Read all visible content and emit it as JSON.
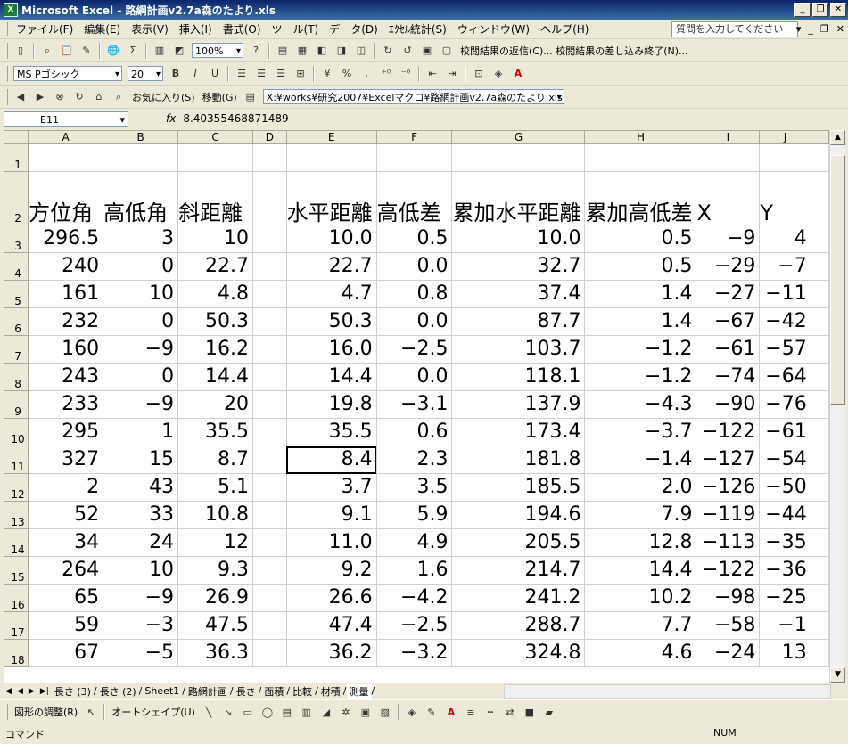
{
  "window": {
    "title": "Microsoft Excel - 路網計画v2.7a森のたより.xls"
  },
  "menu": [
    "ファイル(F)",
    "編集(E)",
    "表示(V)",
    "挿入(I)",
    "書式(O)",
    "ツール(T)",
    "データ(D)",
    "ｴｸｾﾙ統計(S)",
    "ウィンドウ(W)",
    "ヘルプ(H)"
  ],
  "help_placeholder": "質問を入力してください",
  "toolbar1": {
    "zoom": "100%",
    "review_text": "校閲結果の返信(C)... 校閲結果の差し込み終了(N)..."
  },
  "toolbar2": {
    "font": "MS Pゴシック",
    "size": "20",
    "bold": "B",
    "italic": "I",
    "underline": "U",
    "percent": "%",
    "comma": ","
  },
  "toolbar3": {
    "favorites": "お気に入り(S)",
    "goto": "移動(G)",
    "path": "X:¥works¥研究2007¥Excelマクロ¥路網計画v2.7a森のたより.xls"
  },
  "formula": {
    "cell": "E11",
    "fx": "fx",
    "value": "8.40355468871489"
  },
  "columns": [
    "A",
    "B",
    "C",
    "D",
    "E",
    "F",
    "G",
    "H",
    "I",
    "J"
  ],
  "headers": [
    "方位角",
    "高低角",
    "斜距離",
    "",
    "水平距離",
    "高低差",
    "累加水平距離",
    "累加高低差",
    "X",
    "Y"
  ],
  "rows": [
    {
      "n": "3",
      "v": [
        "296.5",
        "3",
        "10",
        "",
        "10.0",
        "0.5",
        "10.0",
        "0.5",
        "−9",
        "4"
      ]
    },
    {
      "n": "4",
      "v": [
        "240",
        "0",
        "22.7",
        "",
        "22.7",
        "0.0",
        "32.7",
        "0.5",
        "−29",
        "−7"
      ]
    },
    {
      "n": "5",
      "v": [
        "161",
        "10",
        "4.8",
        "",
        "4.7",
        "0.8",
        "37.4",
        "1.4",
        "−27",
        "−11"
      ]
    },
    {
      "n": "6",
      "v": [
        "232",
        "0",
        "50.3",
        "",
        "50.3",
        "0.0",
        "87.7",
        "1.4",
        "−67",
        "−42"
      ]
    },
    {
      "n": "7",
      "v": [
        "160",
        "−9",
        "16.2",
        "",
        "16.0",
        "−2.5",
        "103.7",
        "−1.2",
        "−61",
        "−57"
      ]
    },
    {
      "n": "8",
      "v": [
        "243",
        "0",
        "14.4",
        "",
        "14.4",
        "0.0",
        "118.1",
        "−1.2",
        "−74",
        "−64"
      ]
    },
    {
      "n": "9",
      "v": [
        "233",
        "−9",
        "20",
        "",
        "19.8",
        "−3.1",
        "137.9",
        "−4.3",
        "−90",
        "−76"
      ]
    },
    {
      "n": "10",
      "v": [
        "295",
        "1",
        "35.5",
        "",
        "35.5",
        "0.6",
        "173.4",
        "−3.7",
        "−122",
        "−61"
      ]
    },
    {
      "n": "11",
      "v": [
        "327",
        "15",
        "8.7",
        "",
        "8.4",
        "2.3",
        "181.8",
        "−1.4",
        "−127",
        "−54"
      ]
    },
    {
      "n": "12",
      "v": [
        "2",
        "43",
        "5.1",
        "",
        "3.7",
        "3.5",
        "185.5",
        "2.0",
        "−126",
        "−50"
      ]
    },
    {
      "n": "13",
      "v": [
        "52",
        "33",
        "10.8",
        "",
        "9.1",
        "5.9",
        "194.6",
        "7.9",
        "−119",
        "−44"
      ]
    },
    {
      "n": "14",
      "v": [
        "34",
        "24",
        "12",
        "",
        "11.0",
        "4.9",
        "205.5",
        "12.8",
        "−113",
        "−35"
      ]
    },
    {
      "n": "15",
      "v": [
        "264",
        "10",
        "9.3",
        "",
        "9.2",
        "1.6",
        "214.7",
        "14.4",
        "−122",
        "−36"
      ]
    },
    {
      "n": "16",
      "v": [
        "65",
        "−9",
        "26.9",
        "",
        "26.6",
        "−4.2",
        "241.2",
        "10.2",
        "−98",
        "−25"
      ]
    },
    {
      "n": "17",
      "v": [
        "59",
        "−3",
        "47.5",
        "",
        "47.4",
        "−2.5",
        "288.7",
        "7.7",
        "−58",
        "−1"
      ]
    },
    {
      "n": "18",
      "v": [
        "67",
        "−5",
        "36.3",
        "",
        "36.2",
        "−3.2",
        "324.8",
        "4.6",
        "−24",
        "13"
      ]
    }
  ],
  "row_labels_top": [
    "1",
    "2"
  ],
  "active_cell": {
    "row": "11",
    "col": "E"
  },
  "tabs": [
    "長さ (3)",
    "長さ (2)",
    "Sheet1",
    "路網計画",
    "長さ",
    "面積",
    "比較",
    "材積",
    "測量"
  ],
  "active_tab": "測量",
  "drawing": {
    "adjust": "図形の調整(R)",
    "autoshape": "オートシェイプ(U)"
  },
  "status": {
    "mode": "コマンド",
    "num": "NUM"
  }
}
